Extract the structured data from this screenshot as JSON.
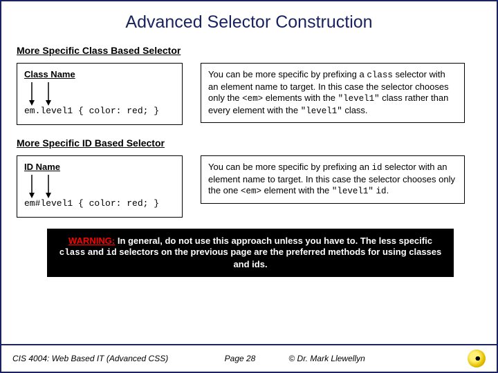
{
  "title": "Advanced Selector Construction",
  "section1": {
    "heading": "More Specific Class Based Selector",
    "box_label": "Class Name",
    "code": "em.level1 { color: red; }",
    "explain_pre": "You can be more specific by prefixing a ",
    "c1": "class",
    "t1": " selector with an element name to target.  In this case the selector chooses only the ",
    "c2": "<em>",
    "t2": " elements with the ",
    "c3": "\"level1\"",
    "t3": " class rather than every element with the ",
    "c4": "\"level1\"",
    "t4": " class."
  },
  "section2": {
    "heading": "More Specific ID Based Selector",
    "box_label": "ID Name",
    "code": "em#level1 { color: red; }",
    "explain_pre": "You can be more specific by prefixing an ",
    "c1": "id",
    "t1": " selector with an element name to target.  In this case the selector chooses only the one ",
    "c2": "<em>",
    "t2": " element with the ",
    "c3": "\"level1\"",
    "t3": " ",
    "c4": "id",
    "t4": "."
  },
  "warning": {
    "label": "WARNING:",
    "t0": "  In general, do not use this approach unless you have to.  The less specific ",
    "c1": "class",
    "t1": " and ",
    "c2": "id",
    "t2": " selectors on the previous page are the preferred methods for using classes and ids."
  },
  "footer": {
    "course": "CIS 4004: Web Based IT (Advanced CSS)",
    "page": "Page 28",
    "copyright": "© Dr. Mark Llewellyn"
  }
}
